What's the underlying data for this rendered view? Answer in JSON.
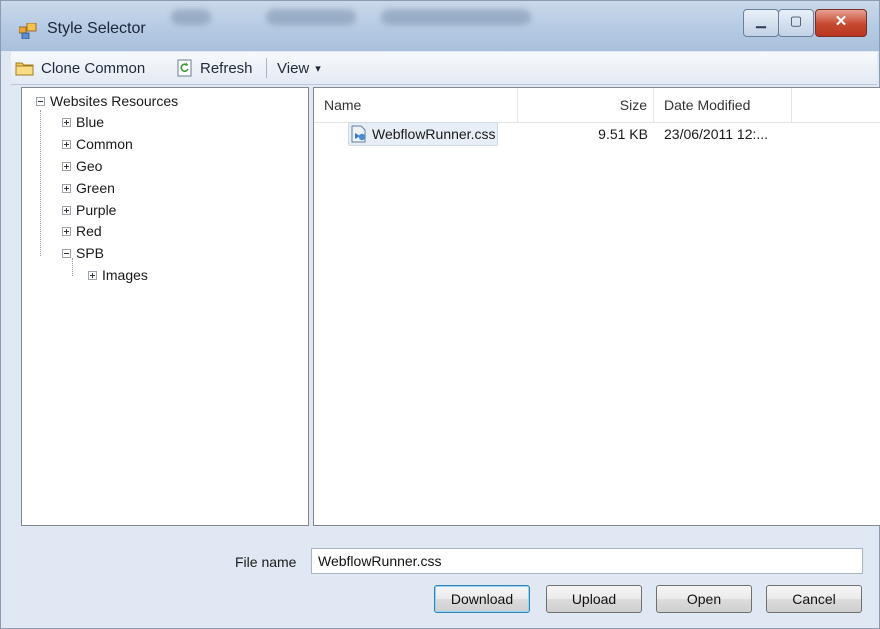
{
  "window": {
    "title": "Style Selector",
    "minimize_glyph": "▁",
    "maximize_glyph": "▢",
    "close_glyph": "✕"
  },
  "toolbar": {
    "clone_common": "Clone Common",
    "refresh": "Refresh",
    "view": "View",
    "view_arrow": "▾"
  },
  "tree": {
    "root": "Websites Resources",
    "items": [
      {
        "label": "Blue"
      },
      {
        "label": "Common"
      },
      {
        "label": "Geo"
      },
      {
        "label": "Green"
      },
      {
        "label": "Purple"
      },
      {
        "label": "Red"
      },
      {
        "label": "SPB",
        "expanded": true,
        "children": [
          {
            "label": "Images"
          }
        ]
      }
    ]
  },
  "list": {
    "columns": [
      "Name",
      "Size",
      "Date Modified"
    ],
    "rows": [
      {
        "name": "WebflowRunner.css",
        "size": "9.51 KB",
        "date": "23/06/2011 12:...",
        "icon": "css-file-icon"
      }
    ]
  },
  "footer": {
    "file_name_label": "File name",
    "file_name_value": "WebflowRunner.css",
    "buttons": {
      "download": "Download",
      "upload": "Upload",
      "open": "Open",
      "cancel": "Cancel"
    }
  },
  "colors": {
    "titlebar": "#b8cde5",
    "close_button": "#c6482f",
    "selection": "#e8eef5",
    "default_button_border": "#3c7fb1"
  }
}
